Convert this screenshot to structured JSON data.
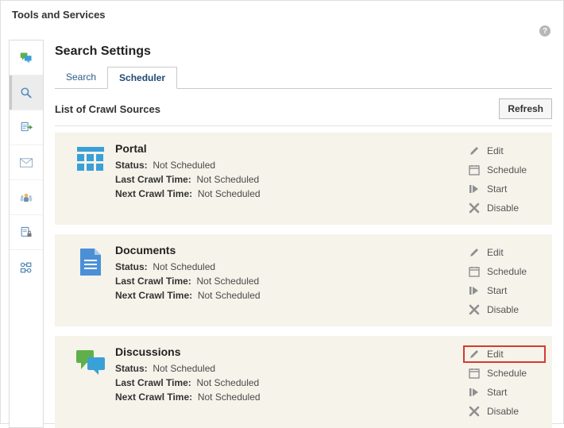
{
  "app": {
    "title": "Tools and Services"
  },
  "page": {
    "title": "Search Settings",
    "tabs": [
      {
        "label": "Search"
      },
      {
        "label": "Scheduler"
      }
    ],
    "active_tab": 1,
    "list_title": "List of Crawl Sources",
    "refresh_label": "Refresh"
  },
  "labels": {
    "status": "Status:",
    "last_crawl": "Last Crawl Time:",
    "next_crawl": "Next Crawl Time:"
  },
  "actions": {
    "edit": "Edit",
    "schedule": "Schedule",
    "start": "Start",
    "disable": "Disable"
  },
  "sources": [
    {
      "name": "Portal",
      "status": "Not Scheduled",
      "last_crawl": "Not Scheduled",
      "next_crawl": "Not Scheduled"
    },
    {
      "name": "Documents",
      "status": "Not Scheduled",
      "last_crawl": "Not Scheduled",
      "next_crawl": "Not Scheduled"
    },
    {
      "name": "Discussions",
      "status": "Not Scheduled",
      "last_crawl": "Not Scheduled",
      "next_crawl": "Not Scheduled"
    }
  ],
  "highlight": {
    "source_index": 2,
    "action_index": 0
  }
}
